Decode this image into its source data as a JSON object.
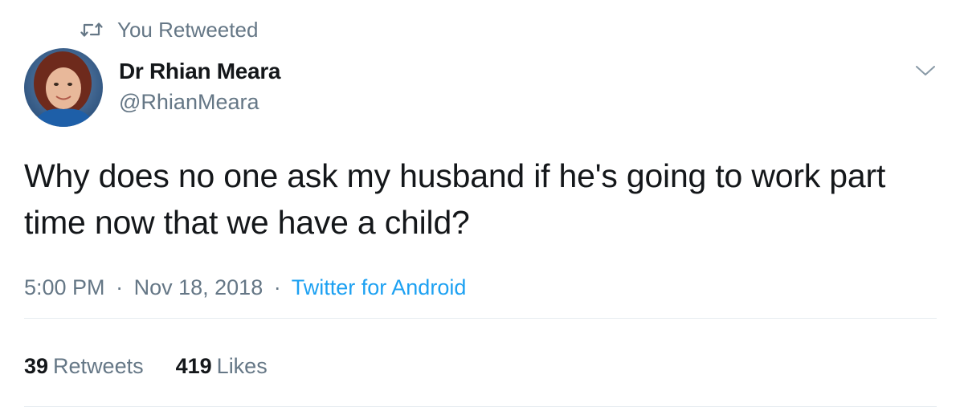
{
  "retweet_context": {
    "label": "You Retweeted",
    "icon": "retweet-icon"
  },
  "author": {
    "display_name": "Dr Rhian Meara",
    "handle": "@RhianMeara"
  },
  "tweet": {
    "text": "Why does no one ask my husband if he's going to work part time now that we have a child?",
    "time": "5:00 PM",
    "separator": "·",
    "date": "Nov 18, 2018",
    "source": "Twitter for Android"
  },
  "stats": {
    "retweets_count": "39",
    "retweets_label": "Retweets",
    "likes_count": "419",
    "likes_label": "Likes"
  },
  "colors": {
    "primary_text": "#14171a",
    "secondary_text": "#657786",
    "link": "#1da1f2",
    "divider": "#e6ecf0"
  }
}
